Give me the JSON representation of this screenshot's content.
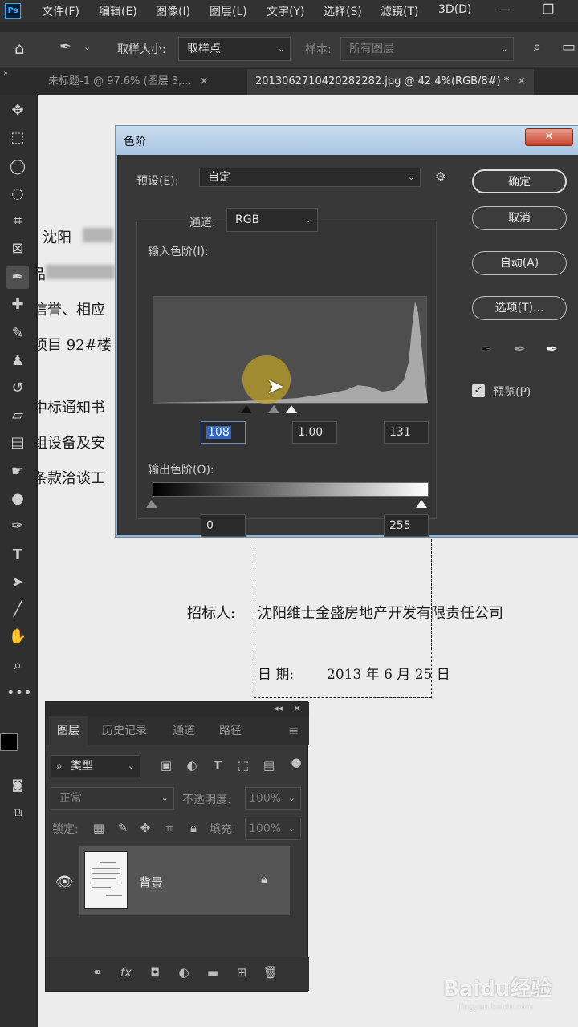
{
  "app": {
    "logo": "Ps"
  },
  "menu": [
    "文件(F)",
    "编辑(E)",
    "图像(I)",
    "图层(L)",
    "文字(Y)",
    "选择(S)",
    "滤镜(T)",
    "3D(D)"
  ],
  "window_controls": {
    "minimize": "—",
    "restore": "❐"
  },
  "options": {
    "sample_size_label": "取样大小:",
    "sample_size_value": "取样点",
    "sample_label": "样本:",
    "sample_value": "所有图层"
  },
  "tabs": [
    {
      "label": "未标题-1 @ 97.6% (图层 3,...",
      "close": "×"
    },
    {
      "label": "20130627104202822​82.jpg @ 42.4%(RGB/8#) *",
      "close": "×"
    }
  ],
  "document": {
    "line1": "沈阳",
    "line2": "品",
    "line3": "信誉、相应",
    "line4": "项目 92#楼",
    "line5": "中标通知书",
    "line6": "组设备及安",
    "line7": "条款洽谈工",
    "bidder_label": "招标人:",
    "bidder_value": "沈阳维士金盛房地产开发有限责任公司",
    "date_label": "日  期:",
    "date_value": "2013 年 6 月 25 日"
  },
  "levels_dialog": {
    "title": "色阶",
    "close": "✕",
    "preset_label": "预设(E):",
    "preset_value": "自定",
    "channel_label": "通道:",
    "channel_value": "RGB",
    "input_label": "输入色阶(I):",
    "input_black": "108",
    "input_gamma": "1.00",
    "input_white": "131",
    "output_label": "输出色阶(O):",
    "output_black": "0",
    "output_white": "255",
    "ok": "确定",
    "cancel": "取消",
    "auto": "自动(A)",
    "options": "选项(T)...",
    "preview_label": "预览(P)",
    "preview_checked": true
  },
  "layers_panel": {
    "collapse": "◂◂",
    "close": "✕",
    "tabs": [
      "图层",
      "历史记录",
      "通道",
      "路径"
    ],
    "filter_value": "类型",
    "blend_mode": "正常",
    "opacity_label": "不透明度:",
    "opacity_value": "100%",
    "lock_label": "锁定:",
    "fill_label": "填充:",
    "fill_value": "100%",
    "layer_name": "背景"
  },
  "watermark": {
    "text": "Baidu经验",
    "sub": "jingyan.baidu.com"
  }
}
